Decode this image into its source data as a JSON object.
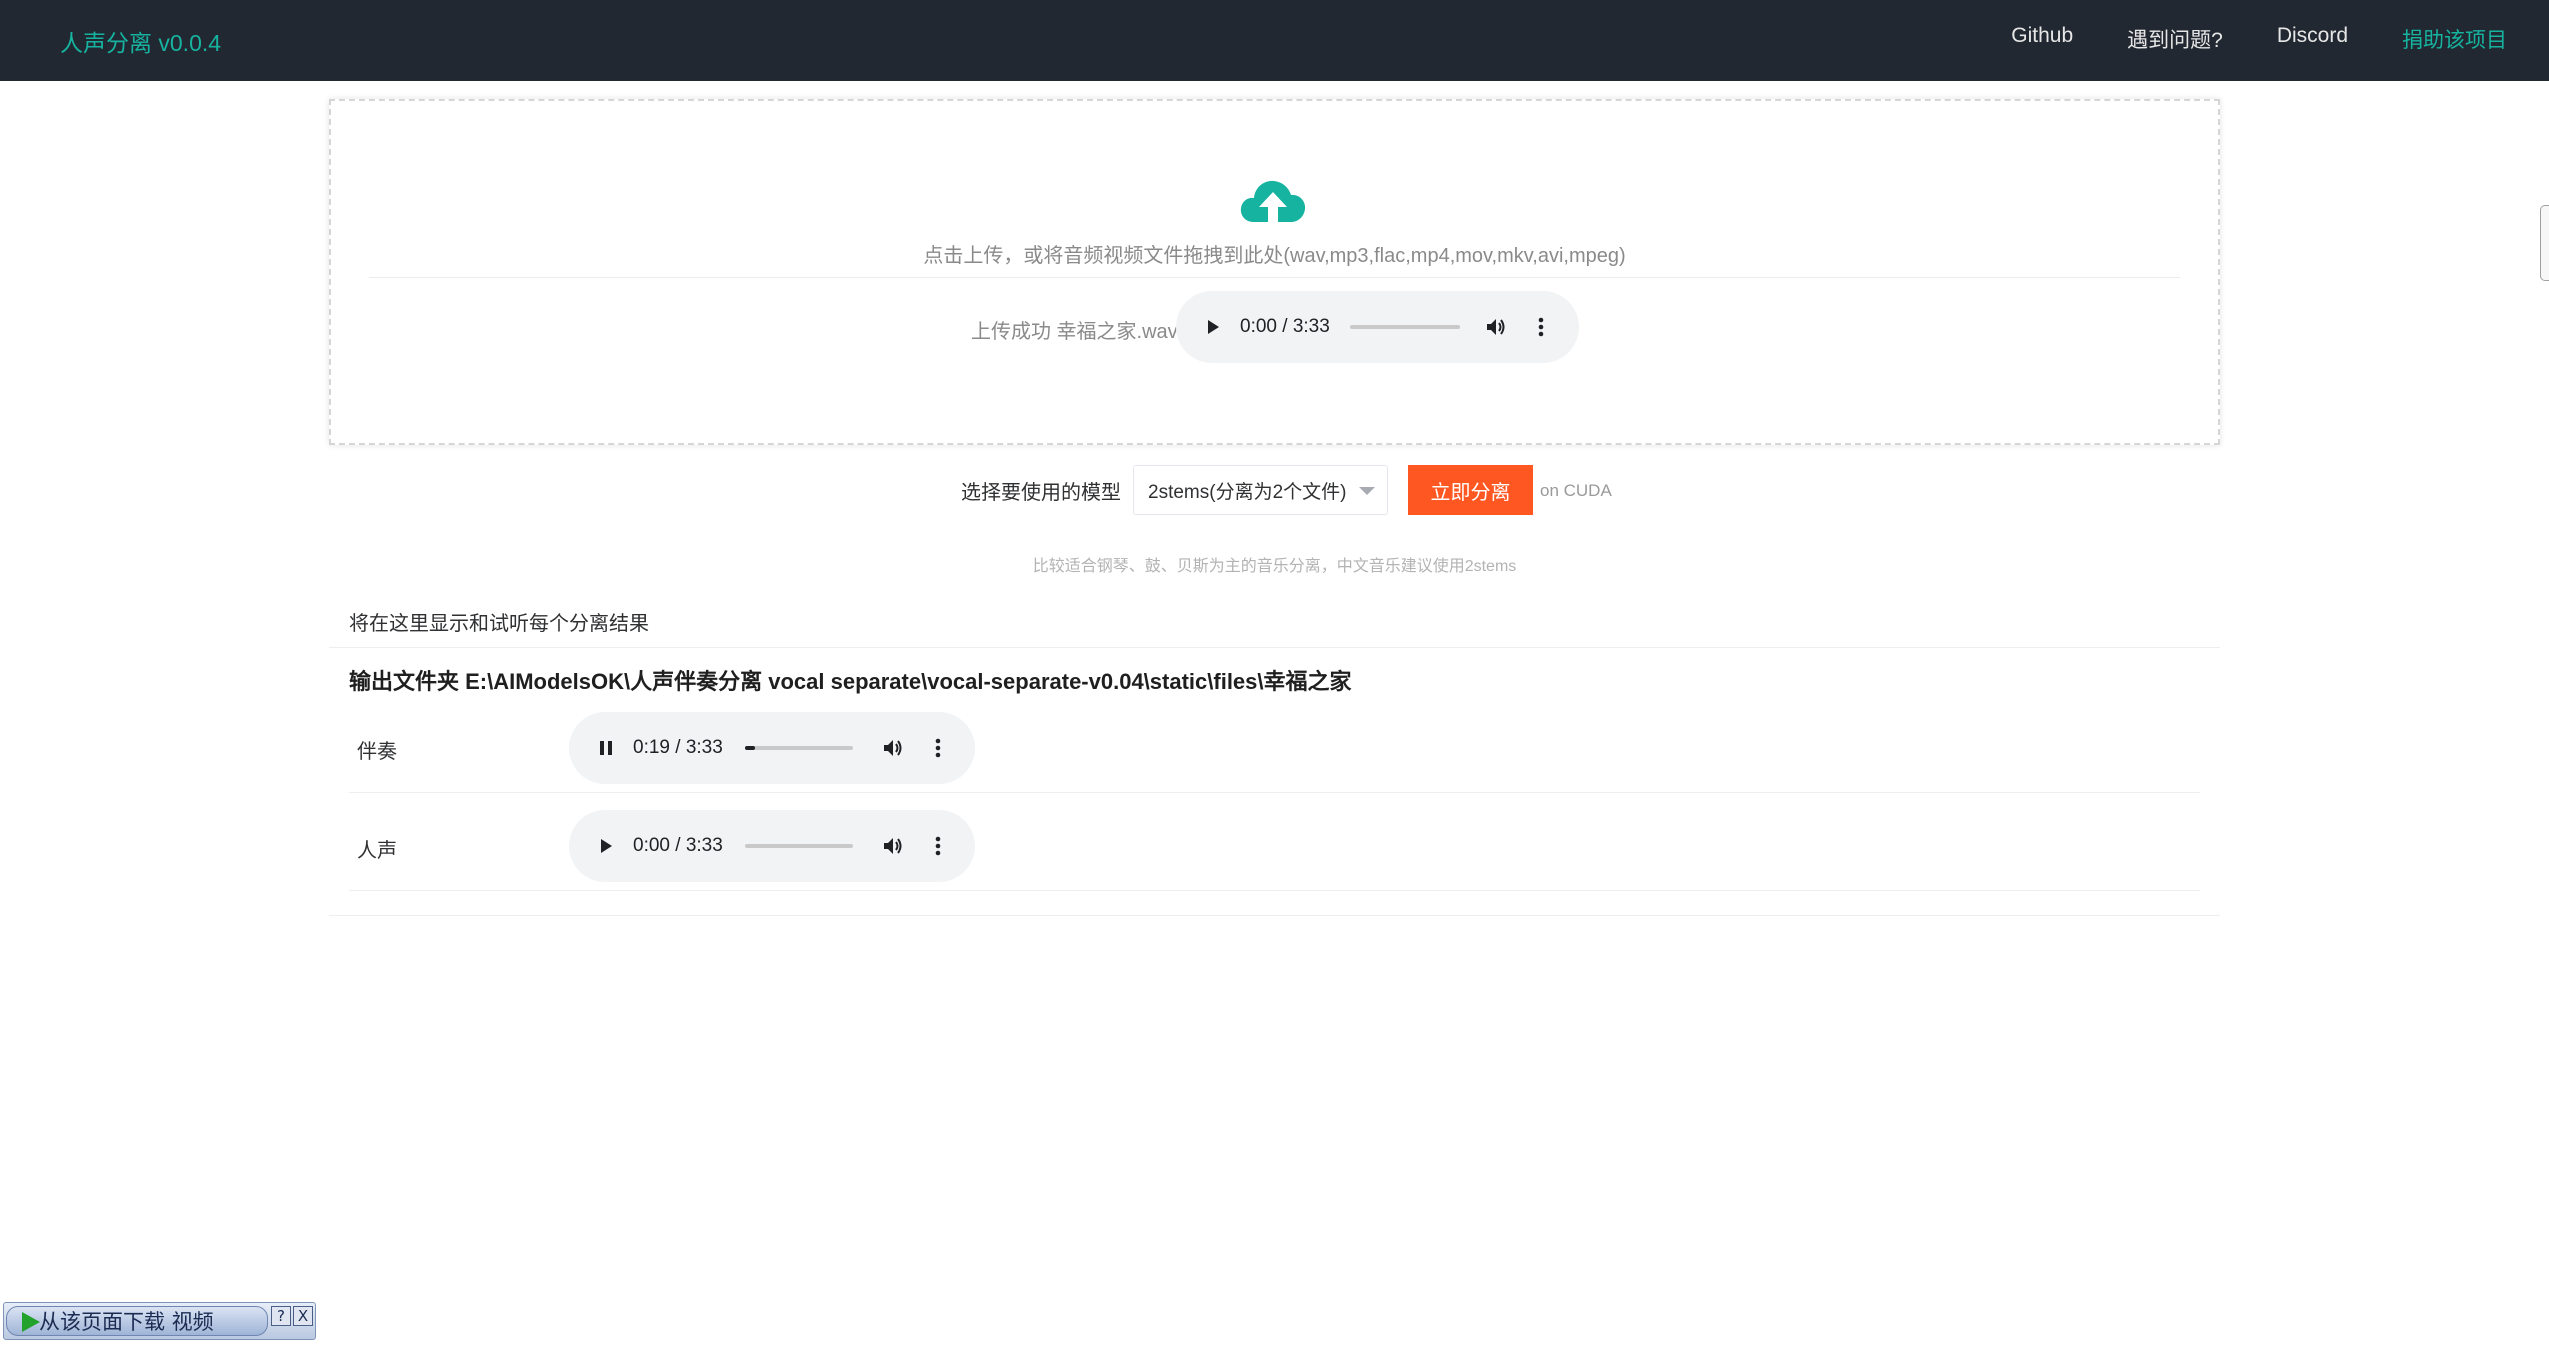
{
  "header": {
    "brand": "人声分离 v0.0.4",
    "nav": [
      "Github",
      "遇到问题?",
      "Discord",
      "捐助该项目"
    ]
  },
  "upload": {
    "icon": "cloud-upload-icon",
    "hint": "点击上传，或将音频视频文件拖拽到此处(wav,mp3,flac,mp4,mov,mkv,avi,mpeg)",
    "status": "上传成功 幸福之家.wav",
    "player": {
      "time": "0:00 / 3:33",
      "progress": 0.0,
      "playing": false
    }
  },
  "model": {
    "label": "选择要使用的模型",
    "selected": "2stems(分离为2个文件)",
    "button": "立即分离",
    "device": "on CUDA",
    "tip": "比较适合钢琴、鼓、贝斯为主的音乐分离，中文音乐建议使用2stems"
  },
  "results": {
    "intro": "将在这里显示和试听每个分离结果",
    "output_path": "输出文件夹 E:\\AIModelsOK\\人声伴奏分离 vocal separate\\vocal-separate-v0.04\\static\\files\\幸福之家",
    "tracks": [
      {
        "label": "伴奏",
        "time": "0:19 / 3:33",
        "progress": 0.09,
        "playing": true
      },
      {
        "label": "人声",
        "time": "0:00 / 3:33",
        "progress": 0.0,
        "playing": false
      }
    ]
  },
  "download_widget": {
    "label": "从该页面下载 视频",
    "help": "?",
    "close": "X"
  },
  "colors": {
    "accent": "#16b3a0",
    "header_bg": "#222831",
    "button": "#ff5722"
  }
}
